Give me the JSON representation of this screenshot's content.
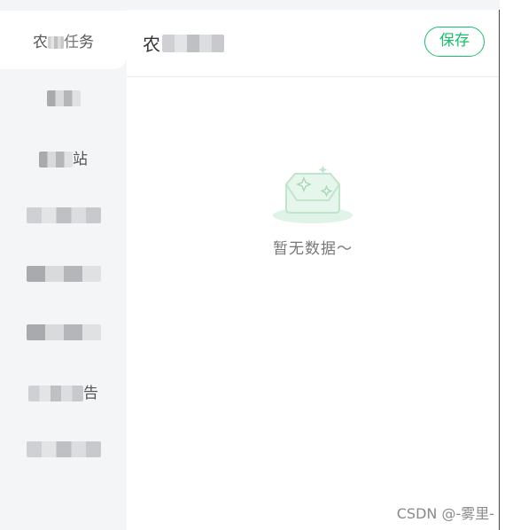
{
  "sidebar": {
    "items": [
      {
        "label": "农事任务",
        "visible_chars": [
          "农",
          "务"
        ],
        "active": true
      },
      {
        "label": "",
        "visible_chars": []
      },
      {
        "label": "站",
        "visible_chars": [
          "站"
        ]
      },
      {
        "label": "",
        "visible_chars": []
      },
      {
        "label": "",
        "visible_chars": []
      },
      {
        "label": "",
        "visible_chars": []
      },
      {
        "label": "告",
        "visible_chars": [
          "告"
        ]
      },
      {
        "label": "",
        "visible_chars": []
      }
    ]
  },
  "header": {
    "title_prefix": "农",
    "save_label": "保存"
  },
  "empty_state": {
    "text": "暂无数据～",
    "icon": "empty-box-icon"
  },
  "watermark": "CSDN @-雾里-",
  "colors": {
    "accent": "#19be6b",
    "sidebar_bg": "#f4f5f7",
    "empty_icon": "#d8f0df"
  }
}
